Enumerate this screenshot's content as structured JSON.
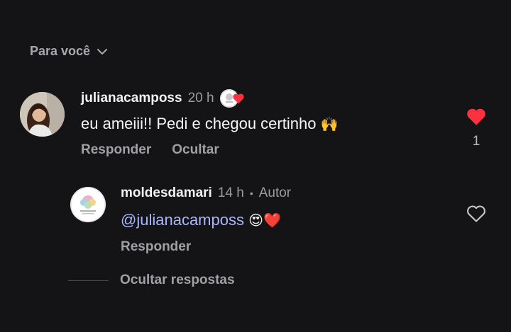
{
  "sort": {
    "label": "Para você"
  },
  "comment": {
    "username": "julianacamposs",
    "time": "20 h",
    "text": "eu ameiii!! Pedi e chegou certinho",
    "emoji": "🙌",
    "reply_label": "Responder",
    "hide_label": "Ocultar",
    "likes": "1",
    "liked": true
  },
  "reply": {
    "username": "moldesdamari",
    "time": "14 h",
    "author_label": "Autor",
    "mention": "@julianacamposs",
    "emoji": "😍❤️",
    "reply_label": "Responder",
    "liked": false
  },
  "hide_replies_label": "Ocultar respostas",
  "colors": {
    "background": "#141416",
    "like_red": "#ff3040",
    "mention_blue": "#a8b6ff",
    "secondary_text": "#a0a0a5"
  },
  "icons": {
    "sort_chevron": "chevron-down-icon",
    "like": "heart-icon",
    "creator_liked": "creator-liked-badge"
  }
}
